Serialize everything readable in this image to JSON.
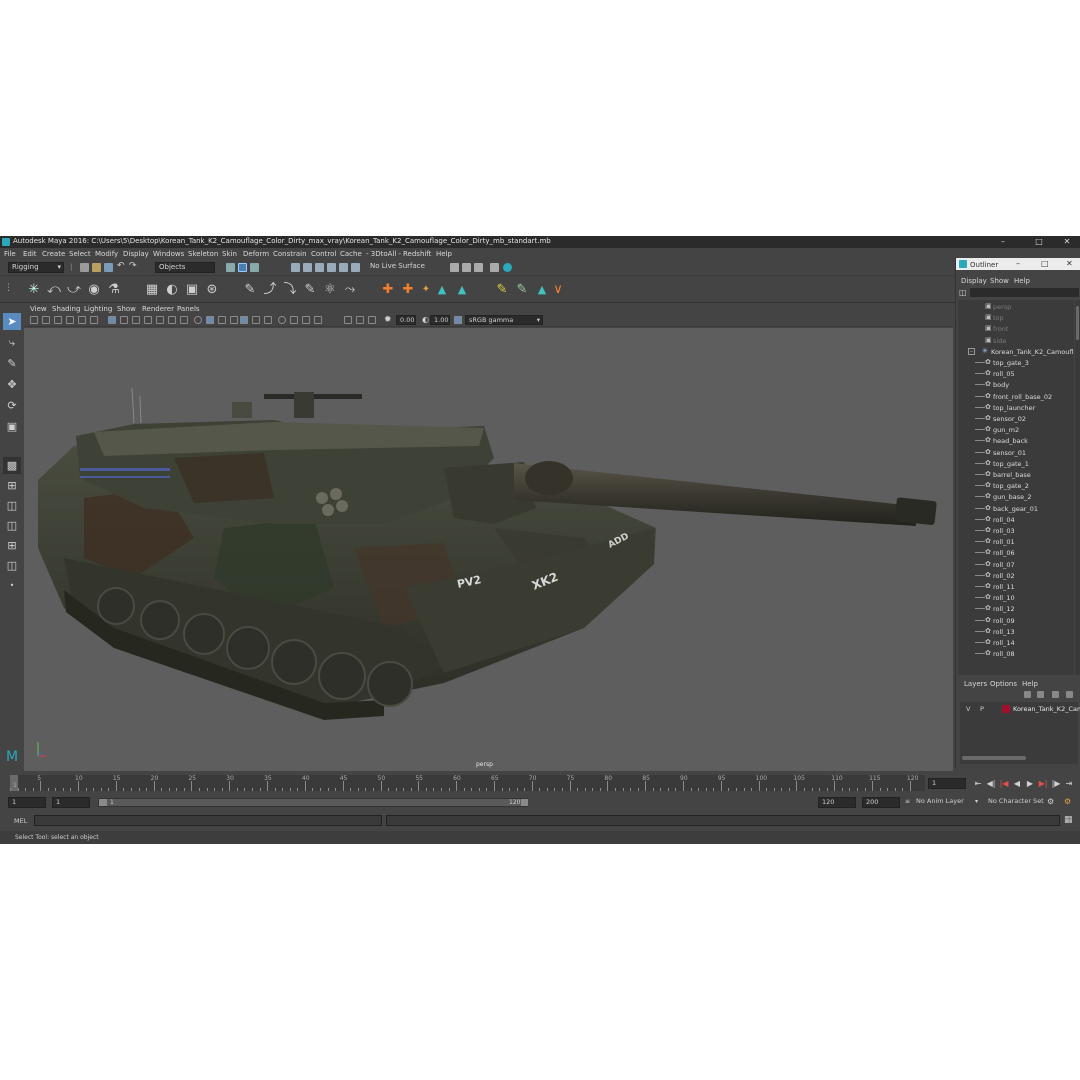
{
  "window": {
    "title": "Autodesk Maya 2016: C:\\Users\\5\\Desktop\\Korean_Tank_K2_Camouflage_Color_Dirty_max_vray\\Korean_Tank_K2_Camouflage_Color_Dirty_mb_standart.mb"
  },
  "menubar": [
    "File",
    "Edit",
    "Create",
    "Select",
    "Modify",
    "Display",
    "Windows",
    "Skeleton",
    "Skin",
    "Deform",
    "Constrain",
    "Control",
    "Cache",
    "- 3DtoAll -",
    "Redshift",
    "Help"
  ],
  "statusline": {
    "menuset": "Rigging",
    "select_mode": "Objects",
    "live_surface": "No Live Surface"
  },
  "viewport": {
    "menu": [
      "View",
      "Shading",
      "Lighting",
      "Show",
      "Renderer",
      "Panels"
    ],
    "exposure": "0.00",
    "gamma": "1.00",
    "color_space": "sRGB gamma",
    "camera_label": "persp",
    "decals": [
      "PV2",
      "XK2",
      "ADD"
    ]
  },
  "outliner": {
    "title": "Outliner",
    "menu": [
      "Display",
      "Show",
      "Help"
    ],
    "cameras": [
      "persp",
      "top",
      "front",
      "side"
    ],
    "root": "Korean_Tank_K2_Camouflage",
    "children": [
      "top_gate_3",
      "roll_05",
      "body",
      "front_roll_base_02",
      "top_launcher",
      "sensor_02",
      "gun_m2",
      "head_back",
      "sensor_01",
      "top_gate_1",
      "barrel_base",
      "top_gate_2",
      "gun_base_2",
      "back_gear_01",
      "roll_04",
      "roll_03",
      "roll_01",
      "roll_06",
      "roll_07",
      "roll_02",
      "roll_11",
      "roll_10",
      "roll_12",
      "roll_09",
      "roll_13",
      "roll_14",
      "roll_08"
    ]
  },
  "layers": {
    "menu": [
      "Layers",
      "Options",
      "Help"
    ],
    "row": {
      "v": "V",
      "p": "P",
      "name": "Korean_Tank_K2_Camo"
    },
    "layer_color": "#a0102a"
  },
  "timeslider": {
    "ticks": [
      "5",
      "10",
      "15",
      "20",
      "25",
      "30",
      "35",
      "40",
      "45",
      "50",
      "55",
      "60",
      "65",
      "70",
      "75",
      "80",
      "85",
      "90",
      "95",
      "100",
      "105",
      "110",
      "115",
      "120"
    ],
    "first_tick": "1",
    "current_frame": "1"
  },
  "rangeslider": {
    "start": "1",
    "playback_start": "1",
    "range_start_label": "1",
    "range_end_label": "120",
    "playback_end": "120",
    "end": "200",
    "anim_layer": "No Anim Layer",
    "character_set": "No Character Set"
  },
  "cmdline": {
    "label": "MEL"
  },
  "helpline": {
    "text": "Select Tool: select an object"
  },
  "colors": {
    "accent": "#2aa9b8",
    "viewport_bg": "#5e5e5e",
    "panel_bg": "#444444"
  }
}
